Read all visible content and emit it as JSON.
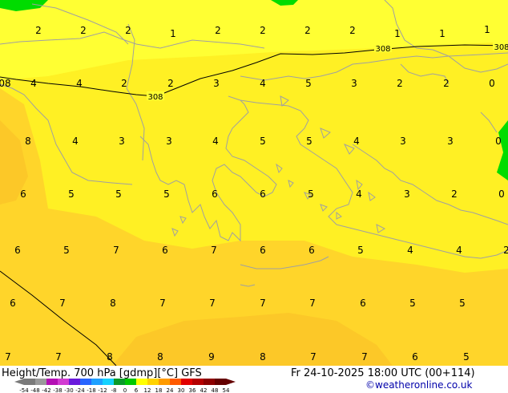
{
  "map": {
    "contour_label": "308",
    "numbers": [
      [
        "2",
        "2",
        "2",
        "1",
        "2",
        "2",
        "2",
        "2",
        "1",
        "1",
        "1"
      ],
      [
        "08",
        "4",
        "4",
        "2",
        "2",
        "3",
        "4",
        "5",
        "3",
        "2",
        "2",
        "0"
      ],
      [
        "8",
        "4",
        "3",
        "3",
        "4",
        "5",
        "5",
        "4",
        "3",
        "3",
        "0"
      ],
      [
        "6",
        "5",
        "5",
        "5",
        "6",
        "6",
        "5",
        "4",
        "3",
        "2",
        "0"
      ],
      [
        "6",
        "5",
        "7",
        "6",
        "7",
        "6",
        "6",
        "5",
        "4",
        "4",
        "2"
      ],
      [
        "6",
        "7",
        "8",
        "7",
        "7",
        "7",
        "7",
        "6",
        "5",
        "5"
      ],
      [
        "7",
        "7",
        "8",
        "8",
        "9",
        "8",
        "7",
        "7",
        "6",
        "5"
      ]
    ],
    "colors": {
      "yellow_light": "#ffff33",
      "yellow": "#fff024",
      "yellow_dark": "#ffd52a",
      "orange": "#fcc828",
      "green": "#00dc00",
      "coast": "#a0a0a0"
    }
  },
  "footer": {
    "title": "Height/Temp. 700 hPa [gdmp][°C] GFS",
    "datetime": "Fr 24-10-2025 18:00 UTC (00+114)",
    "credit": "©weatheronline.co.uk",
    "scale_labels": [
      "-54",
      "-48",
      "-42",
      "-38",
      "-30",
      "-24",
      "-18",
      "-12",
      "-8",
      "0",
      "6",
      "12",
      "18",
      "24",
      "30",
      "36",
      "42",
      "48",
      "54"
    ],
    "scale_colors": [
      "#7a7a7a",
      "#9a9a9a",
      "#b40fb4",
      "#d23cd2",
      "#6a1adc",
      "#2864ff",
      "#1ea0ff",
      "#14d2ff",
      "#0a9a2a",
      "#00c800",
      "#ffff00",
      "#ffd200",
      "#ff9b00",
      "#ff5a00",
      "#e10000",
      "#b40000",
      "#8c0000",
      "#640000"
    ]
  }
}
